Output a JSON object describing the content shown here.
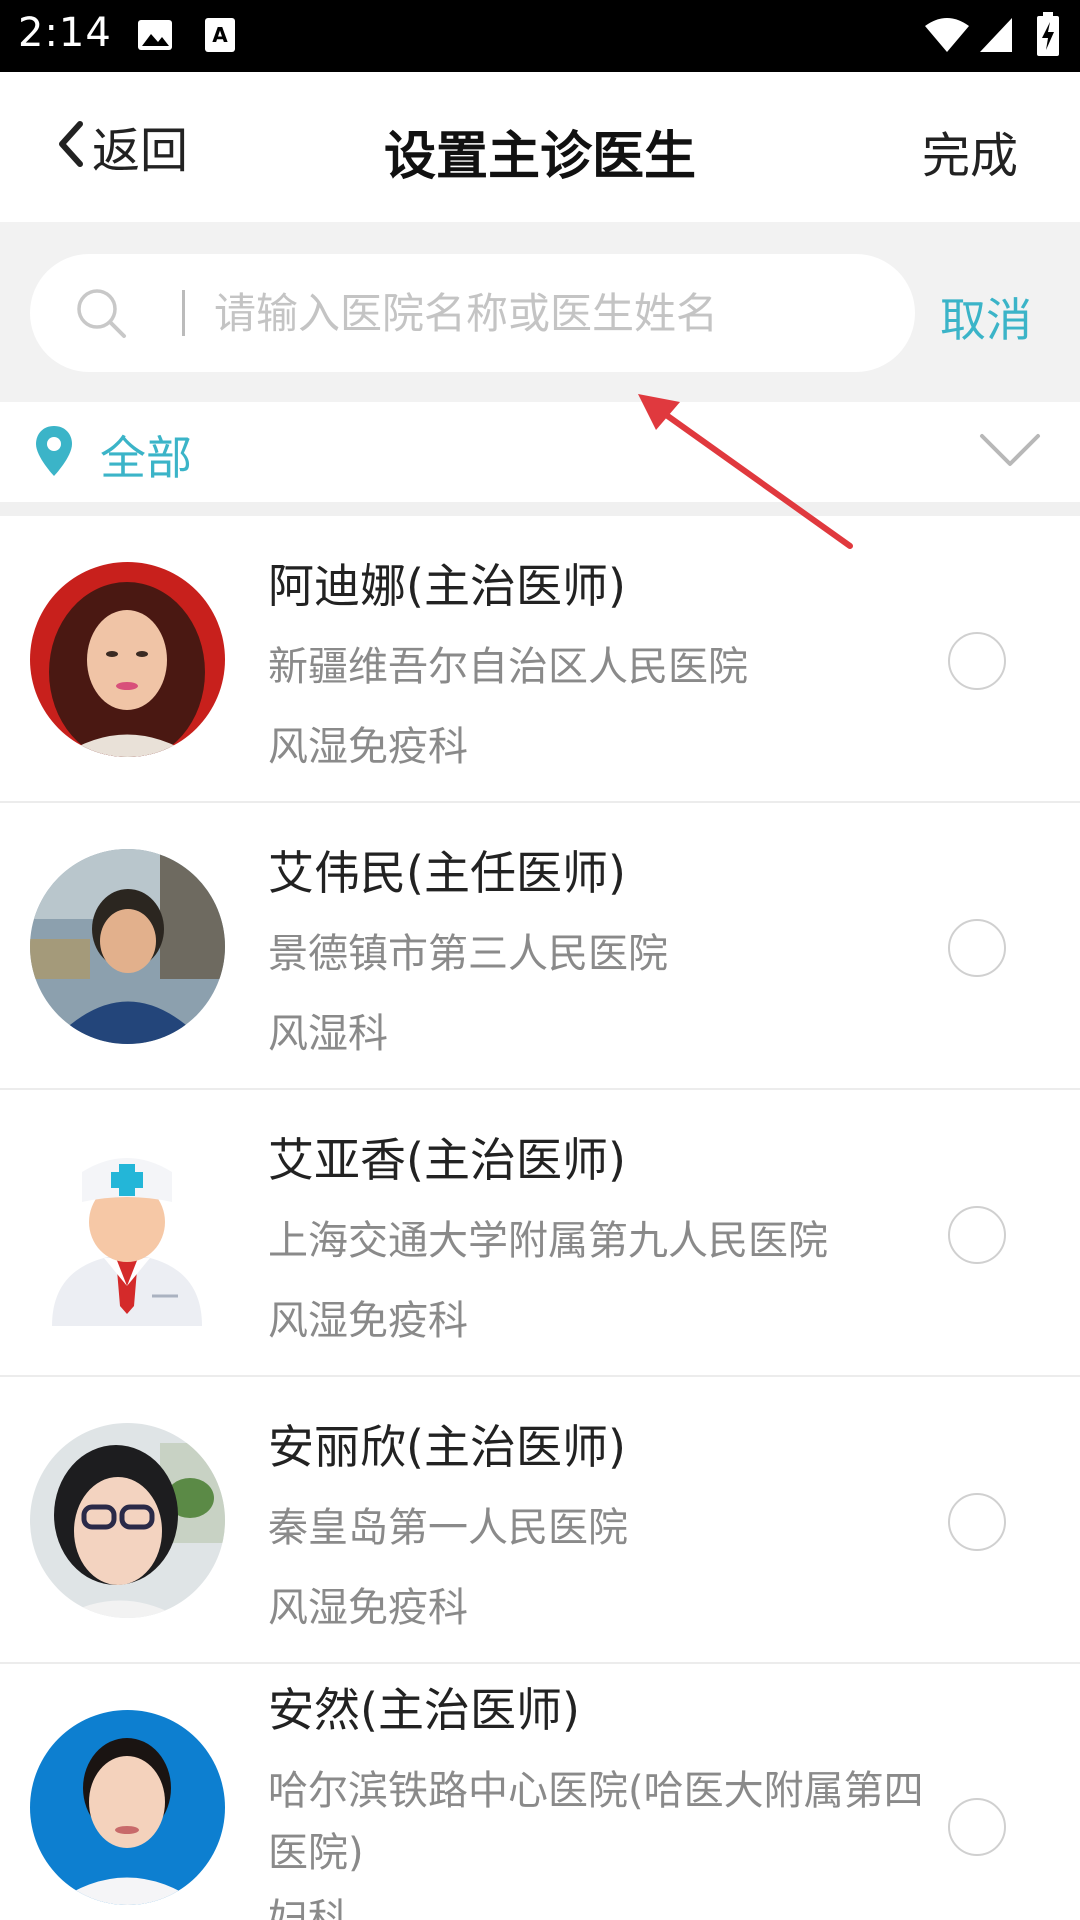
{
  "status_bar": {
    "time": "2:14",
    "icons": [
      "image-icon",
      "text-a-icon",
      "wifi-icon",
      "signal-icon",
      "battery-charging-icon"
    ]
  },
  "navbar": {
    "back_label": "返回",
    "title": "设置主诊医生",
    "done_label": "完成"
  },
  "search": {
    "placeholder": "请输入医院名称或医生姓名",
    "value": "",
    "cancel_label": "取消"
  },
  "filter": {
    "label": "全部"
  },
  "colors": {
    "accent": "#3bb4c8",
    "annotation_arrow": "#e0393e"
  },
  "doctors": [
    {
      "name": "阿迪娜(主治医师)",
      "hospital": "新疆维吾尔自治区人民医院",
      "department": "风湿免疫科",
      "avatar": "photo-avatar",
      "selected": false
    },
    {
      "name": "艾伟民(主任医师)",
      "hospital": "景德镇市第三人民医院",
      "department": "风湿科",
      "avatar": "photo-avatar",
      "selected": false
    },
    {
      "name": "艾亚香(主治医师)",
      "hospital": "上海交通大学附属第九人民医院",
      "department": "风湿免疫科",
      "avatar": "default-doctor-icon",
      "selected": false
    },
    {
      "name": "安丽欣(主治医师)",
      "hospital": "秦皇岛第一人民医院",
      "department": "风湿免疫科",
      "avatar": "photo-avatar",
      "selected": false
    },
    {
      "name": "安然(主治医师)",
      "hospital": "哈尔滨铁路中心医院(哈医大附属第四医院)",
      "department": "妇科",
      "avatar": "photo-avatar",
      "selected": false
    }
  ]
}
